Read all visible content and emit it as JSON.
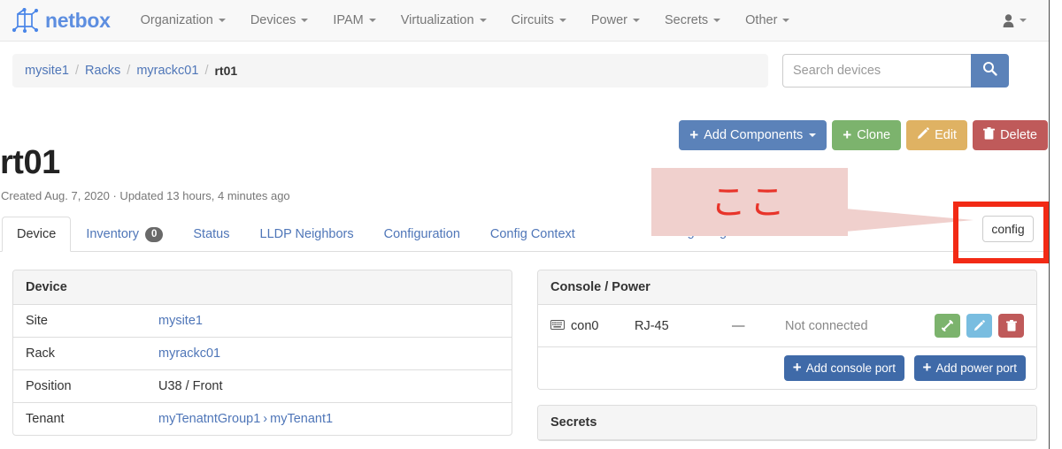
{
  "brand": {
    "name": "netbox",
    "logo_icon": "netbox-logo-icon"
  },
  "navbar": {
    "items": [
      {
        "label": "Organization",
        "has_caret": true
      },
      {
        "label": "Devices",
        "has_caret": true
      },
      {
        "label": "IPAM",
        "has_caret": true
      },
      {
        "label": "Virtualization",
        "has_caret": true
      },
      {
        "label": "Circuits",
        "has_caret": true
      },
      {
        "label": "Power",
        "has_caret": true
      },
      {
        "label": "Secrets",
        "has_caret": true
      },
      {
        "label": "Other",
        "has_caret": true
      }
    ],
    "user_menu_icon": "user-icon"
  },
  "breadcrumb": {
    "items": [
      "mysite1",
      "Racks",
      "myrackc01"
    ],
    "current": "rt01",
    "separator": "/"
  },
  "search": {
    "placeholder": "Search devices",
    "value": "",
    "button_icon": "search-icon"
  },
  "actions": [
    {
      "label": "Add Components",
      "icon": "plus-icon",
      "caret": true,
      "color": "#5b82b9"
    },
    {
      "label": "Clone",
      "icon": "plus-icon",
      "caret": false,
      "color": "#7cb36d"
    },
    {
      "label": "Edit",
      "icon": "pencil-icon",
      "caret": false,
      "color": "#dfb263"
    },
    {
      "label": "Delete",
      "icon": "trash-icon",
      "caret": false,
      "color": "#bf5a5a"
    }
  ],
  "page": {
    "title": "rt01",
    "meta": "Created Aug. 7, 2020 · Updated 13 hours, 4 minutes ago"
  },
  "tabs": [
    {
      "label": "Device",
      "active": true,
      "badge": null
    },
    {
      "label": "Inventory",
      "active": false,
      "badge": "0"
    },
    {
      "label": "Status",
      "active": false,
      "badge": null
    },
    {
      "label": "LLDP Neighbors",
      "active": false,
      "badge": null
    },
    {
      "label": "Configuration",
      "active": false,
      "badge": null
    },
    {
      "label": "Config Context",
      "active": false,
      "badge": null
    }
  ],
  "hidden_tab": {
    "label": "Change Log"
  },
  "device_panel": {
    "title": "Device",
    "rows": [
      {
        "label": "Site",
        "value": "mysite1",
        "link": true
      },
      {
        "label": "Rack",
        "value": "myrackc01",
        "link": true
      },
      {
        "label": "Position",
        "value": "U38 / Front",
        "link": false
      },
      {
        "label": "Tenant",
        "value": "myTenatntGroup1",
        "value2": "myTenant1",
        "sep": "›",
        "link": true
      }
    ]
  },
  "console_panel": {
    "title": "Console / Power",
    "row": {
      "icon": "keyboard-icon",
      "name": "con0",
      "type": "RJ-45",
      "dash": "—",
      "status": "Not connected",
      "buttons": [
        {
          "icon": "connect-cable-icon",
          "color": "#7cb36d"
        },
        {
          "icon": "pencil-icon",
          "color": "#79bde0"
        },
        {
          "icon": "trash-icon",
          "color": "#bf5a5a"
        }
      ]
    },
    "footer_buttons": [
      {
        "label": "Add console port",
        "icon": "plus-icon"
      },
      {
        "label": "Add power port",
        "icon": "plus-icon"
      }
    ]
  },
  "secrets_panel": {
    "title": "Secrets"
  },
  "annotation": {
    "text": "ここ",
    "box_color": "#f0d0cd",
    "text_color": "#e8342a",
    "highlight_border_color": "#f22a15",
    "target_button_label": "config"
  }
}
